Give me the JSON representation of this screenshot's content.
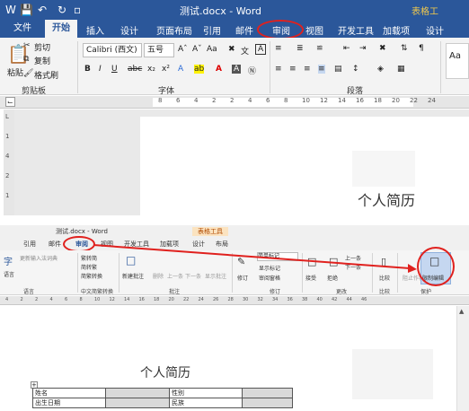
{
  "top": {
    "doc_title": "测试.docx - Word",
    "context_title": "表格工",
    "qat_icons": [
      "word-icon",
      "save-icon",
      "undo-icon",
      "redo-icon",
      "touch-mode-icon"
    ],
    "tabs": [
      "文件",
      "开始",
      "插入",
      "设计",
      "页面布局",
      "引用",
      "邮件",
      "审阅",
      "视图",
      "开发工具",
      "加载项",
      "设计"
    ],
    "clipboard": {
      "cut": "剪切",
      "copy": "复制",
      "paste": "粘贴",
      "format_painter": "格式刷",
      "group": "剪贴板"
    },
    "font": {
      "name": "Calibri (西文)",
      "size": "五号",
      "group": "字体"
    },
    "paragraph_group": "段落",
    "styles_preview": "Aa",
    "ruler_numbers": [
      "8",
      "6",
      "4",
      "2",
      "2",
      "4",
      "6",
      "8",
      "10",
      "12",
      "14",
      "16",
      "18",
      "20",
      "22",
      "24"
    ],
    "vruler_numbers": [
      "L",
      "1",
      "4",
      "2",
      "1"
    ],
    "doc_heading": "个人简历"
  },
  "bottom": {
    "doc_title": "测试.docx - Word",
    "context_title": "表格工具",
    "tabs": [
      "引用",
      "邮件",
      "审阅",
      "视图",
      "开发工具",
      "加载项",
      "设计",
      "布局"
    ],
    "language": {
      "btn": "语言",
      "update": "更新输入法词典",
      "group": "语言"
    },
    "chinese": {
      "to_trad": "繁转简",
      "to_simp": "简转繁",
      "convert": "简繁转换",
      "group": "中文简繁转换"
    },
    "comments": {
      "new": "新建批注",
      "delete": "删除",
      "prev": "上一条",
      "next": "下一条",
      "show": "显示批注",
      "group": "批注"
    },
    "tracking": {
      "track": "修订",
      "markup": "简单标记",
      "show_markup": "显示标记",
      "pane": "审阅窗格",
      "group": "修订"
    },
    "changes": {
      "accept": "接受",
      "reject": "拒绝",
      "prev": "上一条",
      "next": "下一条",
      "group": "更改"
    },
    "compare": {
      "btn": "比较",
      "group": "比较"
    },
    "protect": {
      "block": "阻止作者",
      "restrict": "限制编辑",
      "group": "保护"
    },
    "ruler_numbers": [
      "4",
      "2",
      "2",
      "4",
      "6",
      "8",
      "10",
      "12",
      "14",
      "16",
      "18",
      "20",
      "22",
      "24",
      "26",
      "28",
      "30",
      "32",
      "34",
      "36",
      "38",
      "40",
      "42",
      "44",
      "46"
    ],
    "doc_heading": "个人简历",
    "form_rows": [
      [
        "姓名",
        "",
        "性别",
        ""
      ],
      [
        "出生日期",
        "",
        "民族",
        ""
      ]
    ]
  },
  "colors": {
    "word_blue": "#2b579a",
    "annotation_red": "#e0211e"
  }
}
